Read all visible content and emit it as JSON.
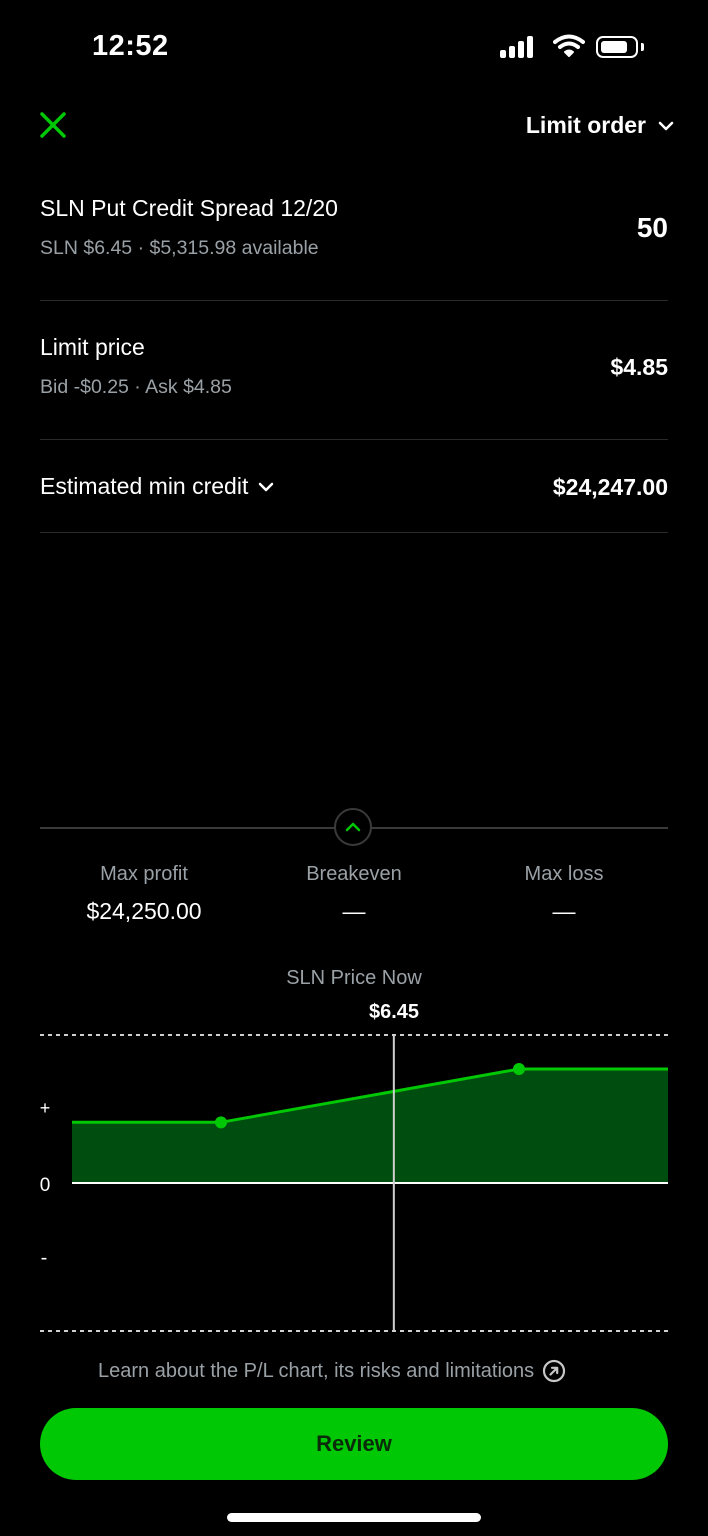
{
  "status_bar": {
    "time": "12:52"
  },
  "header": {
    "order_type": "Limit order"
  },
  "position": {
    "title": "SLN Put Credit Spread 12/20",
    "subtitle": "SLN $6.45 · $5,315.98 available",
    "quantity": "50"
  },
  "limit_price": {
    "title": "Limit price",
    "subtitle": "Bid -$0.25 · Ask $4.85",
    "value": "$4.85"
  },
  "estimate": {
    "title": "Estimated min credit",
    "value": "$24,247.00"
  },
  "stats": {
    "max_profit_label": "Max profit",
    "max_profit_value": "$24,250.00",
    "breakeven_label": "Breakeven",
    "breakeven_value": "—",
    "max_loss_label": "Max loss",
    "max_loss_value": "—"
  },
  "chart_data": {
    "type": "area",
    "title": "SLN Price Now",
    "current_price_label": "$6.45",
    "y_tick_labels": [
      "+",
      "0",
      "-"
    ],
    "series": [
      {
        "x": [
          0,
          0.25,
          0.75,
          1.0
        ],
        "values": [
          0.41,
          0.41,
          0.77,
          0.77
        ]
      }
    ],
    "current_price_position": 0.54,
    "colors": {
      "line": "#00c805",
      "fill": "#004d10"
    }
  },
  "learn_link": "Learn about the P/L chart, its risks and limitations",
  "review_button": "Review",
  "colors": {
    "accent": "#00c805",
    "muted": "#9aa1a6"
  },
  "icons": {
    "close": "close-icon",
    "dropdown": "chevron-down-icon",
    "collapse": "chevron-up-icon",
    "external": "external-link-icon"
  }
}
